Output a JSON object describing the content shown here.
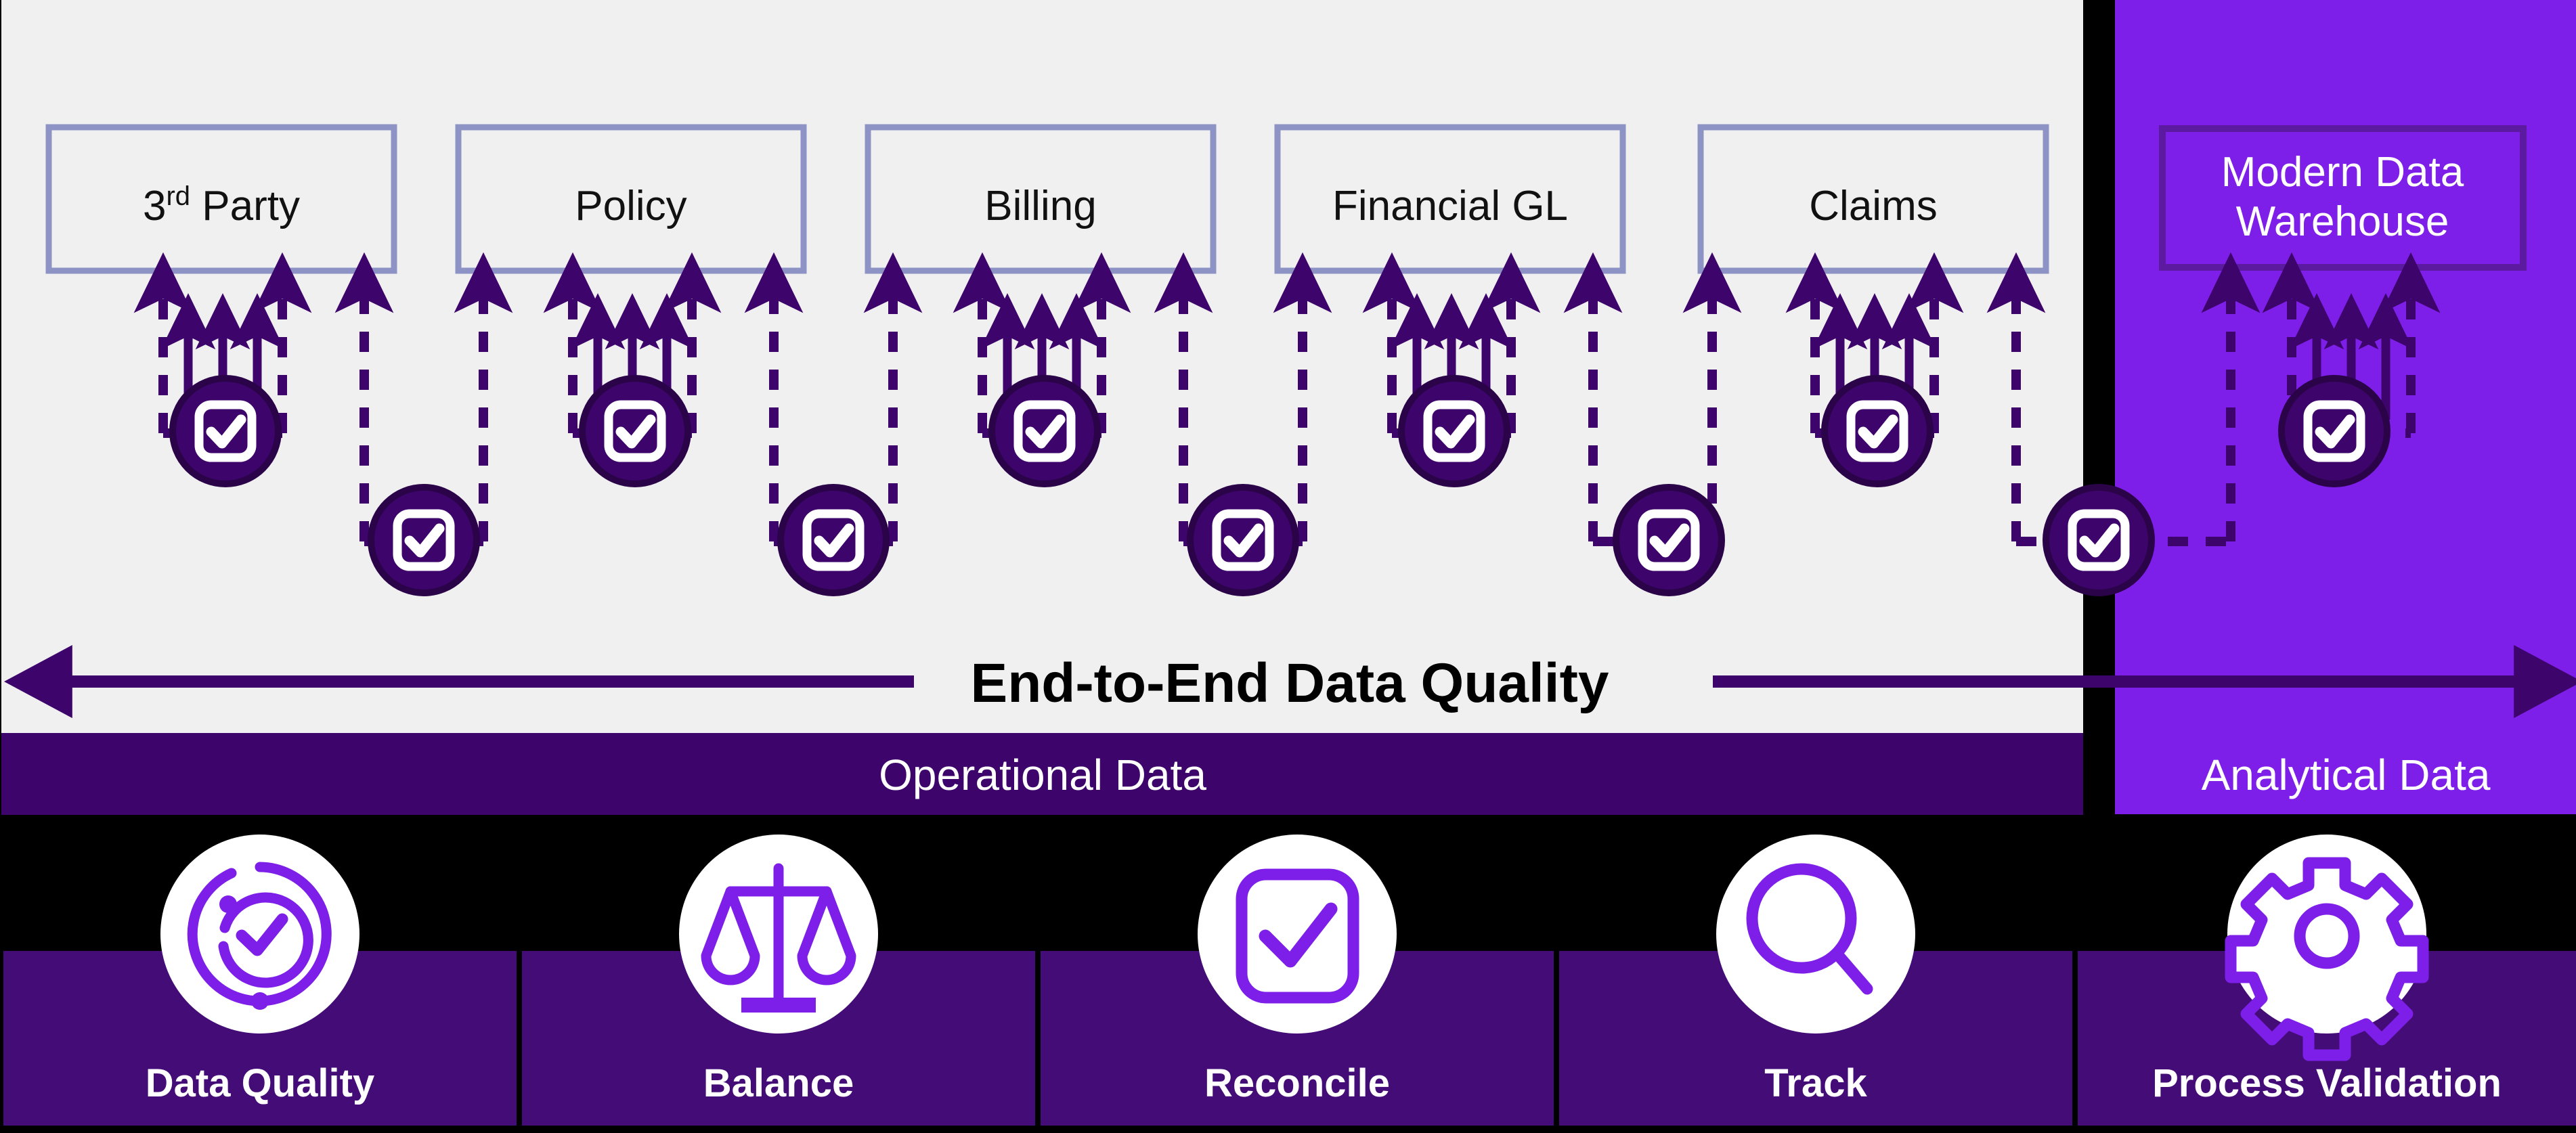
{
  "colors": {
    "background_black": "#000000",
    "panel_white": "#f0f0f0",
    "panel_bright_purple": "#7d1fe8",
    "band_dark_purple": "#3d056b",
    "tile_purple": "#430c77",
    "box_border_periwinkle": "#8d93c4",
    "arrow_purple": "#3d056b",
    "badge_fill": "#3d056b",
    "badge_ring": "#2a0349",
    "icon_purple": "#7d1fe8",
    "mdw_border": "#5b1aa0",
    "text_black": "#111111",
    "text_white": "#ffffff"
  },
  "diagram": {
    "source_boxes": [
      {
        "label": "3rd Party",
        "label_main": "3",
        "label_sup": "rd",
        "label_rest": " Party",
        "has_superscript": true
      },
      {
        "label": "Policy",
        "has_superscript": false
      },
      {
        "label": "Billing",
        "has_superscript": false
      },
      {
        "label": "Financial GL",
        "has_superscript": false
      },
      {
        "label": "Claims",
        "has_superscript": false
      }
    ],
    "warehouse_box": {
      "line1": "Modern Data",
      "line2": "Warehouse"
    },
    "check_badges_top_count": 6,
    "check_badges_bottom_count": 5,
    "check_badge_icon": "check-square-icon",
    "end_to_end": {
      "label": "End-to-End Data Quality",
      "left_arrow": "left-arrow",
      "right_arrow": "right-arrow"
    },
    "bands": [
      {
        "label": "Operational Data",
        "region": "left"
      },
      {
        "label": "Analytical Data",
        "region": "right"
      }
    ]
  },
  "capability_tiles": [
    {
      "label": "Data Quality",
      "icon": "gauge-check-icon"
    },
    {
      "label": "Balance",
      "icon": "scales-icon"
    },
    {
      "label": "Reconcile",
      "icon": "check-square-icon"
    },
    {
      "label": "Track",
      "icon": "magnifier-icon"
    },
    {
      "label": "Process Validation",
      "icon": "gear-icon"
    }
  ]
}
